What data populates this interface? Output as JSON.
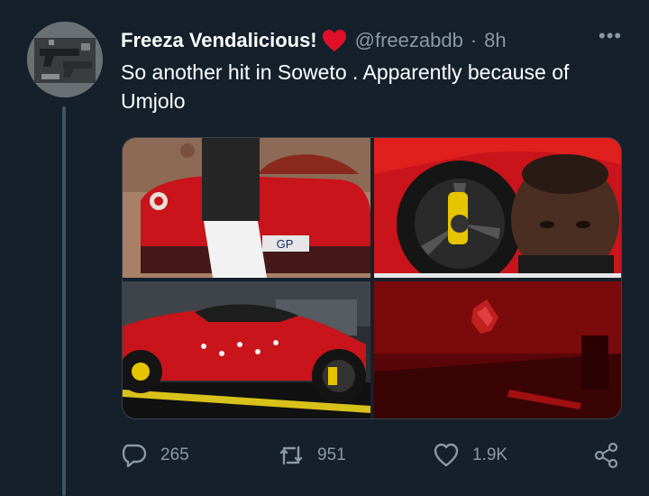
{
  "tweet": {
    "author_name": "Freeza Vendalicious!",
    "author_emoji": "red-heart",
    "handle": "@freezabdb",
    "separator": "·",
    "time": "8h",
    "more_label": "•••",
    "text": "So another hit in Soweto . Apparently because of Umjolo",
    "plate_text": "GP"
  },
  "actions": {
    "replies": "265",
    "retweets": "951",
    "likes": "1.9K"
  },
  "colors": {
    "background": "#15202b",
    "secondary_text": "#8b98a5",
    "heart": "#f91880",
    "thread_line": "#3d5466"
  },
  "icons": {
    "reply": "reply-icon",
    "retweet": "retweet-icon",
    "like": "like-icon",
    "share": "share-icon",
    "more": "more-icon"
  }
}
